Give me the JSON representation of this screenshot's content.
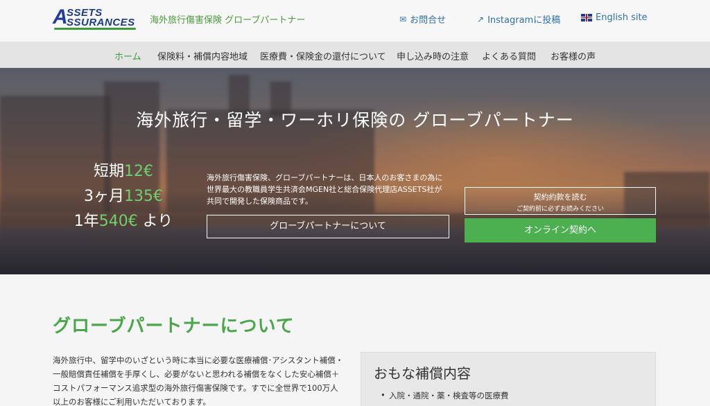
{
  "header": {
    "logo_line1": "SSETS",
    "logo_line2": "SSURANCES",
    "logo_letter": "A",
    "tagline": "海外旅行傷害保険 グローブパートナー",
    "links": [
      {
        "label": "お問合せ",
        "icon": "mail-icon"
      },
      {
        "label": "Instagramに投稿",
        "icon": "share-icon"
      },
      {
        "label": "English site",
        "icon": "uk-flag-icon"
      }
    ]
  },
  "nav": {
    "items": [
      {
        "label": "ホーム",
        "active": true
      },
      {
        "label": "保険料・補償内容地域",
        "active": false
      },
      {
        "label": "医療費・保険金の還付について",
        "active": false
      },
      {
        "label": "申し込み時の注意",
        "active": false
      },
      {
        "label": "よくある質問",
        "active": false
      },
      {
        "label": "お客様の声",
        "active": false
      }
    ]
  },
  "hero": {
    "title": "海外旅行・留学・ワーホリ保険の グローブパートナー",
    "prices": [
      {
        "prefix": "短期",
        "amount": "12€",
        "suffix": ""
      },
      {
        "prefix": "3ヶ月",
        "amount": "135€",
        "suffix": ""
      },
      {
        "prefix": "1年",
        "amount": "540€",
        "suffix": " より"
      }
    ],
    "description": "海外旅行傷害保険、グローブパートナーは、日本人のお客さまの為に世界最大の教職員学生共済会MGEN社と総合保険代理店ASSETS社が共同で開発した保険商品です。",
    "about_button": "グローブパートナーについて",
    "terms_button": "契約約款を読む",
    "terms_sub": "ご契約前に必ずお読みください",
    "online_button": "オンライン契約へ"
  },
  "about": {
    "title": "グローブパートナーについて",
    "text": "海外旅行中、留学中のいざという時に本当に必要な医療補償･アシスタント補償・一般賠償責任補償を手厚くし、必要がないと思われる補償をなくした安心補償＋コストパフォーマンス追求型の海外旅行傷害保険です。すでに全世界で100万人以上のお客様にご利用いただいております。"
  },
  "coverage": {
    "title": "おもな補償内容",
    "items": [
      "入院・通院・薬・検査等の医療費"
    ]
  },
  "colors": {
    "accent_green": "#4caf50",
    "link_blue": "#2f6fa8",
    "nav_bg": "#e4e4e4"
  }
}
